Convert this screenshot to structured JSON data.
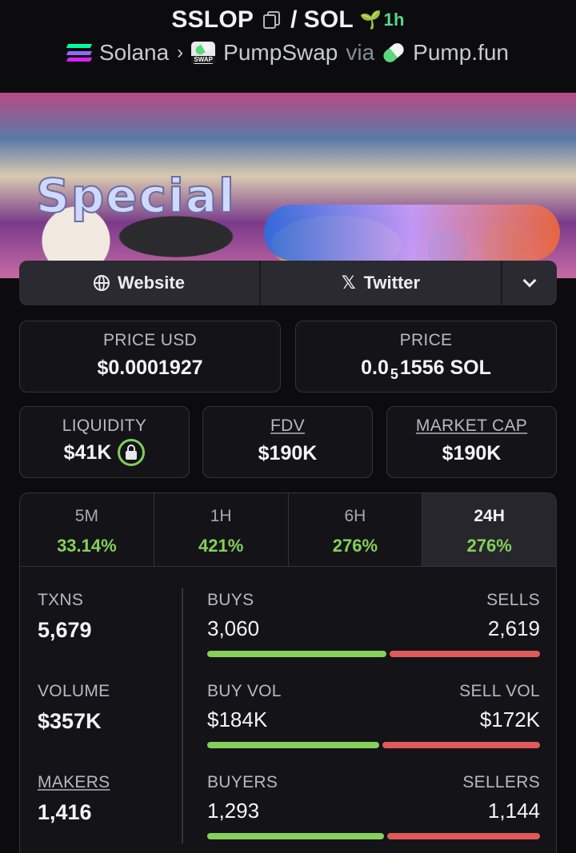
{
  "header": {
    "token": "SSLOP",
    "separator": "/",
    "quote": "SOL",
    "age": "1h",
    "chain": "Solana",
    "dex": "PumpSwap",
    "dex_badge": "SWAP",
    "via": "via",
    "launchpad": "Pump.fun"
  },
  "links": {
    "website": "Website",
    "twitter": "Twitter"
  },
  "price": {
    "usd_label": "PRICE USD",
    "usd_value": "$0.0001927",
    "native_label": "PRICE",
    "native_prefix": "0.0",
    "native_zeros": "5",
    "native_rest": "1556 SOL"
  },
  "metrics": {
    "liquidity_label": "LIQUIDITY",
    "liquidity_value": "$41K",
    "fdv_label": "FDV",
    "fdv_value": "$190K",
    "mcap_label": "MARKET CAP",
    "mcap_value": "$190K"
  },
  "tabs": [
    {
      "label": "5M",
      "value": "33.14%"
    },
    {
      "label": "1H",
      "value": "421%"
    },
    {
      "label": "6H",
      "value": "276%"
    },
    {
      "label": "24H",
      "value": "276%"
    }
  ],
  "stats": {
    "txns_label": "TXNS",
    "txns_value": "5,679",
    "volume_label": "VOLUME",
    "volume_value": "$357K",
    "makers_label": "MAKERS",
    "makers_value": "1,416",
    "buys_label": "BUYS",
    "buys_value": "3,060",
    "sells_label": "SELLS",
    "sells_value": "2,619",
    "buyvol_label": "BUY VOL",
    "buyvol_value": "$184K",
    "sellvol_label": "SELL VOL",
    "sellvol_value": "$172K",
    "buyers_label": "BUYERS",
    "buyers_value": "1,293",
    "sellers_label": "SELLERS",
    "sellers_value": "1,144",
    "buys_share": 0.539,
    "buyvol_share": 0.517,
    "buyers_share": 0.531
  },
  "colors": {
    "positive": "#86d05a",
    "negative": "#e05a5a",
    "age": "#58d68d"
  }
}
